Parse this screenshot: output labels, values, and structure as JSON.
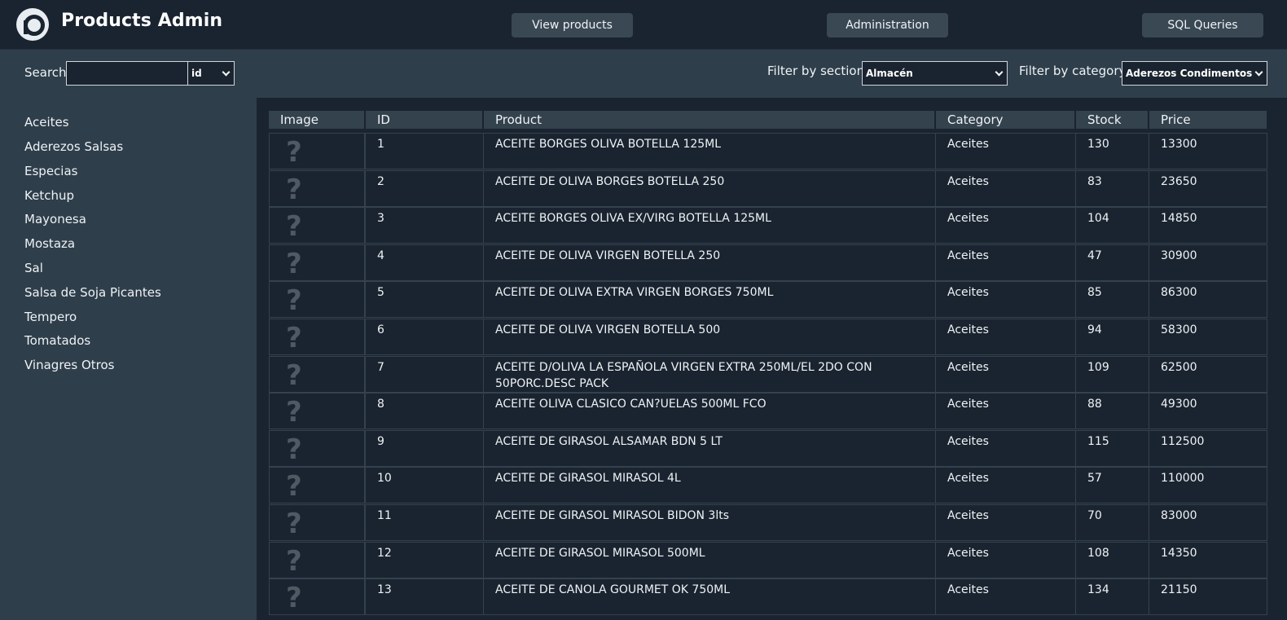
{
  "header": {
    "title": "Products Admin",
    "nav": [
      "View products",
      "Administration",
      "SQL Queries"
    ]
  },
  "filters": {
    "search_label": "Search",
    "search_value": "",
    "search_field": "id",
    "section_label": "Filter by section",
    "section_value": "Almacén",
    "category_label": "Filter by category",
    "category_value": "Aderezos Condimentos"
  },
  "sidebar": {
    "items": [
      "Aceites",
      "Aderezos Salsas",
      "Especias",
      "Ketchup",
      "Mayonesa",
      "Mostaza",
      "Sal",
      "Salsa de Soja Picantes",
      "Tempero",
      "Tomatados",
      "Vinagres Otros"
    ]
  },
  "table": {
    "columns": [
      "Image",
      "ID",
      "Product",
      "Category",
      "Stock",
      "Price"
    ],
    "image_placeholder": "?",
    "rows": [
      [
        "1",
        "ACEITE BORGES OLIVA BOTELLA 125ML",
        "Aceites",
        "130",
        "13300"
      ],
      [
        "2",
        "ACEITE DE OLIVA BORGES BOTELLA 250",
        "Aceites",
        "83",
        "23650"
      ],
      [
        "3",
        "ACEITE BORGES OLIVA EX/VIRG BOTELLA 125ML",
        "Aceites",
        "104",
        "14850"
      ],
      [
        "4",
        "ACEITE DE OLIVA VIRGEN BOTELLA 250",
        "Aceites",
        "47",
        "30900"
      ],
      [
        "5",
        "ACEITE DE OLIVA EXTRA VIRGEN BORGES 750ML",
        "Aceites",
        "85",
        "86300"
      ],
      [
        "6",
        "ACEITE DE OLIVA VIRGEN BOTELLA 500",
        "Aceites",
        "94",
        "58300"
      ],
      [
        "7",
        "ACEITE D/OLIVA LA ESPAÑOLA VIRGEN EXTRA 250ML/EL 2DO CON 50PORC.DESC PACK",
        "Aceites",
        "109",
        "62500"
      ],
      [
        "8",
        "ACEITE OLIVA CLASICO CAN?UELAS 500ML FCO",
        "Aceites",
        "88",
        "49300"
      ],
      [
        "9",
        "ACEITE DE GIRASOL ALSAMAR BDN 5 LT",
        "Aceites",
        "115",
        "112500"
      ],
      [
        "10",
        "ACEITE DE GIRASOL MIRASOL 4L",
        "Aceites",
        "57",
        "110000"
      ],
      [
        "11",
        "ACEITE DE GIRASOL MIRASOL BIDON 3lts",
        "Aceites",
        "70",
        "83000"
      ],
      [
        "12",
        "ACEITE DE GIRASOL MIRASOL 500ML",
        "Aceites",
        "108",
        "14350"
      ],
      [
        "13",
        "ACEITE DE CANOLA GOURMET OK 750ML",
        "Aceites",
        "134",
        "21150"
      ]
    ]
  }
}
